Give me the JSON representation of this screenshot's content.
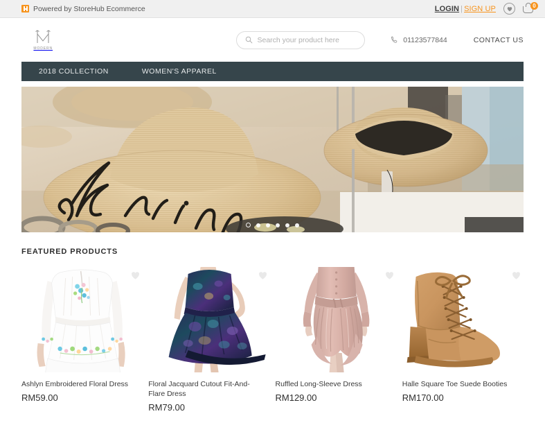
{
  "topbar": {
    "powered_text": "Powered by StoreHub Ecommerce",
    "storehub_icon": "storehub-logo-icon",
    "login_label": "LOGIN",
    "separator": "|",
    "signup_label": "SIGN UP",
    "wishlist_icon": "heart-circle-icon",
    "cart_icon": "shopping-basket-icon",
    "cart_count": "0",
    "accent_color": "#f7941e",
    "background_color": "#f0f0f0"
  },
  "header": {
    "brand_mark_icon": "modern-m-logo-icon",
    "brand_name": "MODERN",
    "search": {
      "icon": "search-icon",
      "placeholder": "Search your product here",
      "value": ""
    },
    "phone": {
      "icon": "phone-icon",
      "number": "01123577844"
    },
    "contact_label": "CONTACT US"
  },
  "nav": {
    "background_color": "#36454b",
    "items": [
      {
        "label": "2018 COLLECTION"
      },
      {
        "label": "WOMEN'S APPAREL"
      }
    ]
  },
  "hero": {
    "alt": "Straw sun hats on display, one embroidered with the word darling",
    "slide_text": "darling",
    "dots": [
      {
        "active": true
      },
      {
        "active": false
      },
      {
        "active": false
      },
      {
        "active": false
      },
      {
        "active": false
      },
      {
        "active": false
      }
    ]
  },
  "featured": {
    "title": "FEATURED PRODUCTS",
    "wishlist_icon": "heart-icon",
    "products": [
      {
        "name": "Ashlyn Embroidered Floral Dress",
        "price": "RM59.00",
        "image": "white-embroidered-floral-dress"
      },
      {
        "name": "Floral Jacquard Cutout Fit-And-Flare Dress",
        "price": "RM79.00",
        "image": "navy-purple-jacquard-flare-dress"
      },
      {
        "name": "Ruffled Long-Sleeve Dress",
        "price": "RM129.00",
        "image": "dusty-pink-ruffled-dress"
      },
      {
        "name": "Halle Square Toe Suede Booties",
        "price": "RM170.00",
        "image": "tan-suede-lace-up-bootie"
      }
    ]
  }
}
